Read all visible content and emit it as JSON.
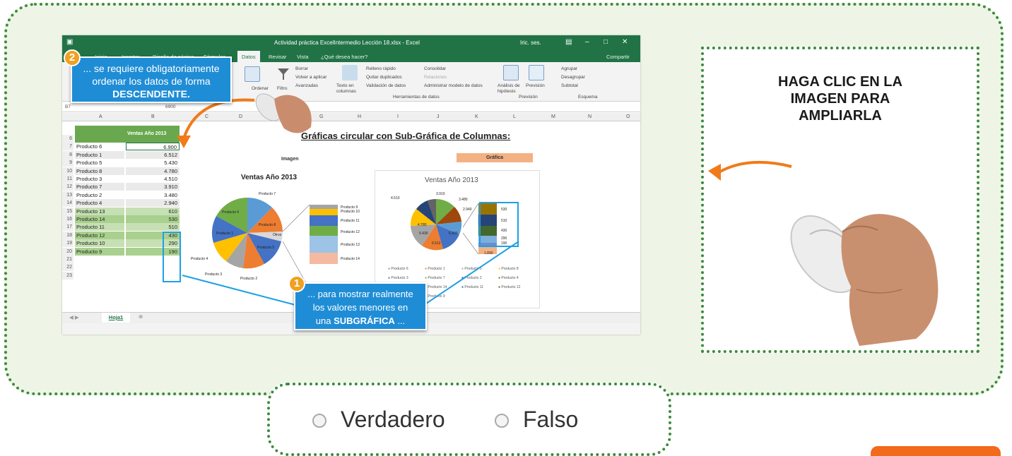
{
  "excel": {
    "title": "Actividad práctica ExcelIntermedio Lección 18.xlsx - Excel",
    "user": "Iric. ses.",
    "tabs": [
      "Inicio",
      "Insertar",
      "Diseño de página",
      "Fórmulas",
      "Datos",
      "Revisar",
      "Vista",
      "¿Qué desea hacer?"
    ],
    "share": "Compartir",
    "ribbon": {
      "ordenar": "Ordenar",
      "filtro": "Filtro",
      "borrar": "Borrar",
      "volver": "Volver a aplicar",
      "avanzadas": "Avanzadas",
      "texto": "Texto en columnas",
      "relleno": "Relleno rápido",
      "quitar": "Quitar duplicados",
      "validacion": "Validación de datos",
      "consolidar": "Consolidar",
      "relaciones": "Relaciones",
      "modelo": "Administrar modelo de datos",
      "hipotesis": "Análisis de hipótesis",
      "prevision": "Previsión",
      "agrupar": "Agrupar",
      "desagrupar": "Desagrupar",
      "subtotal": "Subtotal",
      "grp_herr": "Herramientas de datos",
      "grp_prev": "Previsión",
      "grp_esq": "Esquema"
    },
    "namebox": "B7",
    "formula": "6900",
    "header_cell": "Ventas Año 2013",
    "columns": [
      "A",
      "B",
      "C",
      "D",
      "E",
      "F",
      "G",
      "H",
      "I",
      "J",
      "K",
      "L",
      "M",
      "N",
      "O"
    ],
    "rows": [
      {
        "num": "6",
        "name": "",
        "value": ""
      },
      {
        "num": "7",
        "name": "Producto 6",
        "value": "6.900"
      },
      {
        "num": "8",
        "name": "Producto 1",
        "value": "6.512"
      },
      {
        "num": "9",
        "name": "Producto 5",
        "value": "5.430"
      },
      {
        "num": "10",
        "name": "Producto 8",
        "value": "4.780"
      },
      {
        "num": "11",
        "name": "Producto 3",
        "value": "4.510"
      },
      {
        "num": "12",
        "name": "Producto 7",
        "value": "3.910"
      },
      {
        "num": "13",
        "name": "Producto 2",
        "value": "3.480"
      },
      {
        "num": "14",
        "name": "Producto 4",
        "value": "2.940"
      },
      {
        "num": "15",
        "name": "Producto 13",
        "value": "610"
      },
      {
        "num": "16",
        "name": "Producto 14",
        "value": "530"
      },
      {
        "num": "17",
        "name": "Producto 11",
        "value": "510"
      },
      {
        "num": "18",
        "name": "Producto 12",
        "value": "430"
      },
      {
        "num": "19",
        "name": "Producto 10",
        "value": "290"
      },
      {
        "num": "20",
        "name": "Producto 9",
        "value": "190"
      },
      {
        "num": "21",
        "name": "",
        "value": ""
      },
      {
        "num": "22",
        "name": "",
        "value": ""
      },
      {
        "num": "23",
        "name": "",
        "value": ""
      }
    ],
    "sheet_tab": "Hoja1",
    "chart_heading": "Gráficas circular con Sub-Gráfica de Columnas:",
    "imagen_label": "Imagen",
    "grafica_label": "Gráfica",
    "pie1_title": "Ventas Año 2013",
    "pie1_labels": [
      "Producto 7",
      "Producto 6",
      "Producto 8",
      "Otros",
      "Producto 1",
      "Producto 4",
      "Producto 3",
      "Producto 2",
      "Producto 5"
    ],
    "bar1_labels": [
      "Producto 9",
      "Producto 10",
      "Producto 11",
      "Producto 12",
      "Producto 13",
      "Producto 14"
    ],
    "pie2_title": "Ventas Año 2013",
    "pie2_values": [
      "4.510",
      "3.910",
      "3.480",
      "2.940",
      "4.780",
      "5.430",
      "6.512",
      "6.900",
      "1.890"
    ],
    "bar2_values": [
      "530",
      "510",
      "430",
      "290",
      "190"
    ],
    "legend2": [
      "Producto 6",
      "Producto 1",
      "Producto 5",
      "Producto 8",
      "Producto 3",
      "Producto 7",
      "Producto 2",
      "Producto 4",
      "Producto 13",
      "Producto 14",
      "Producto 11",
      "Producto 12",
      "Producto 10",
      "Producto 9"
    ]
  },
  "callout_top": {
    "badge": "2",
    "line1": "... se requiere obligatoriamente",
    "line2": "ordenar los datos de forma",
    "line3": "DESCENDENTE."
  },
  "callout_bottom": {
    "badge": "1",
    "line1": "... para mostrar realmente",
    "line2": "los valores menores en",
    "line3_pre": "una ",
    "line3_bold": "SUBGRÁFICA",
    "line3_post": " ..."
  },
  "hint": {
    "line1": "HAGA CLIC EN LA",
    "line2": "IMAGEN PARA",
    "line3": "AMPLIARLA"
  },
  "options": {
    "true_label": "Verdadero",
    "false_label": "Falso"
  },
  "colors": {
    "accent_green": "#3d8a3d",
    "callout_blue": "#1f8dd6",
    "orange": "#f26a1b",
    "excel_green": "#217346"
  }
}
